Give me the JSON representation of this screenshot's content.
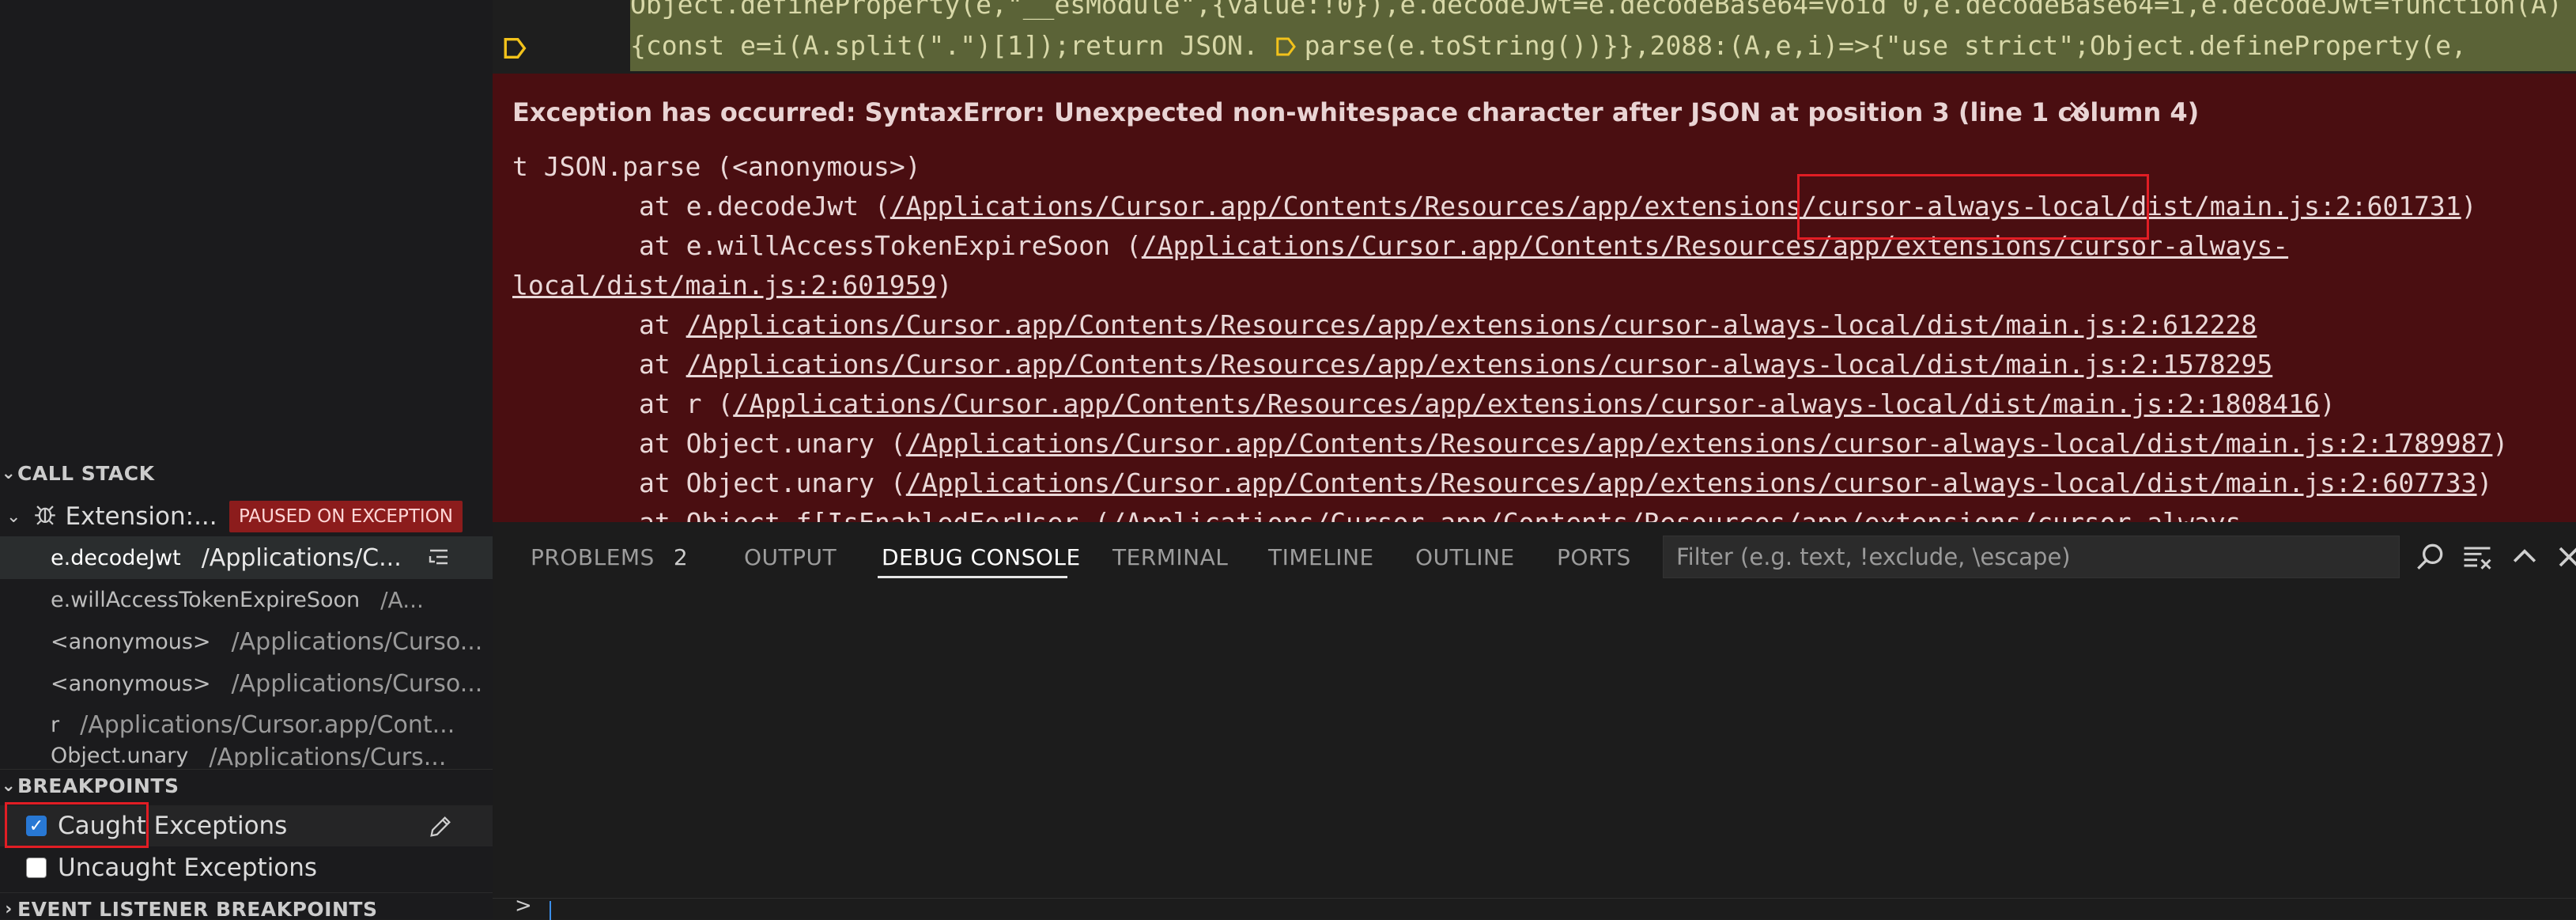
{
  "editor": {
    "code_line_1": "Object.defineProperty(e,\"__esModule\",{value:!0}),e.decodeJwt=e.decodeBase64=void 0,e.decodeBase64=i,e.decodeJwt=function(A)",
    "code_line_2_before": "{const e=i(A.split(\".\")[1]);return JSON.",
    "code_line_2_after": "parse(e.toString())}},2088:(A,e,i)=>{\"use strict\";Object.defineProperty(e,",
    "exception": {
      "title": "Exception has occurred: SyntaxError: Unexpected non-whitespace character after JSON at position 3 (line 1 column 4)",
      "close_glyph": "×",
      "line0": "t JSON.parse (<anonymous>)",
      "frames": [
        {
          "prefix": "at e.decodeJwt (",
          "link": "/Applications/Cursor.app/Contents/Resources/app/extensions/cursor-always-local/dist/main.js:2:601731",
          "suffix": ")"
        },
        {
          "prefix": "at e.willAccessTokenExpireSoon (",
          "link": "/Applications/Cursor.app/Contents/Resources/app/extensions/cursor-always-",
          "suffix": ""
        },
        {
          "prefix": "",
          "link": "local/dist/main.js:2:601959",
          "suffix": ")"
        },
        {
          "prefix": "at ",
          "link": "/Applications/Cursor.app/Contents/Resources/app/extensions/cursor-always-local/dist/main.js:2:612228",
          "suffix": ""
        },
        {
          "prefix": "at ",
          "link": "/Applications/Cursor.app/Contents/Resources/app/extensions/cursor-always-local/dist/main.js:2:1578295",
          "suffix": ""
        },
        {
          "prefix": "at r (",
          "link": "/Applications/Cursor.app/Contents/Resources/app/extensions/cursor-always-local/dist/main.js:2:1808416",
          "suffix": ")"
        },
        {
          "prefix": "at Object.unary (",
          "link": "/Applications/Cursor.app/Contents/Resources/app/extensions/cursor-always-local/dist/main.js:2:1789987",
          "suffix": ")"
        },
        {
          "prefix": "at Object.unary (",
          "link": "/Applications/Cursor.app/Contents/Resources/app/extensions/cursor-always-local/dist/main.js:2:607733",
          "suffix": ")"
        },
        {
          "prefix": "at Object.f[IsEnabledForUser (",
          "link": "/Applications/Cursor.app/Contents/Resources/app/extensions/cursor-always-",
          "suffix": ""
        }
      ]
    }
  },
  "sidebar": {
    "call_stack": {
      "header": "CALL STACK",
      "thread_label": "Extension:...",
      "paused_badge": "PAUSED ON EXCEPTION",
      "frames": [
        {
          "fn": "e.decodeJwt",
          "path": "/Applications/C..."
        },
        {
          "fn": "e.willAccessTokenExpireSoon",
          "path": "/A..."
        },
        {
          "fn": "<anonymous>",
          "path": "/Applications/Curso..."
        },
        {
          "fn": "<anonymous>",
          "path": "/Applications/Curso..."
        },
        {
          "fn": "r",
          "path": "/Applications/Cursor.app/Cont..."
        },
        {
          "fn": "Object.unary",
          "path": "/Applications/Curs..."
        }
      ]
    },
    "breakpoints": {
      "header": "BREAKPOINTS",
      "items": [
        {
          "label": "Caught Exceptions",
          "checked": true
        },
        {
          "label": "Uncaught Exceptions",
          "checked": false
        }
      ]
    },
    "event_listener_header": "EVENT LISTENER BREAKPOINTS"
  },
  "panel": {
    "tabs": [
      {
        "label": "PROBLEMS",
        "count": "2"
      },
      {
        "label": "OUTPUT"
      },
      {
        "label": "DEBUG CONSOLE",
        "active": true
      },
      {
        "label": "TERMINAL"
      },
      {
        "label": "TIMELINE"
      },
      {
        "label": "OUTLINE"
      },
      {
        "label": "PORTS"
      }
    ],
    "filter_placeholder": "Filter (e.g. text, !exclude, \\escape)",
    "prompt": ">"
  },
  "colors": {
    "exception_bg": "#4a0e11",
    "highlight_band": "#5b6337",
    "badge_bg": "#8c1c1c",
    "checkbox_blue": "#2878d4",
    "annotation_red": "#e11d24"
  }
}
